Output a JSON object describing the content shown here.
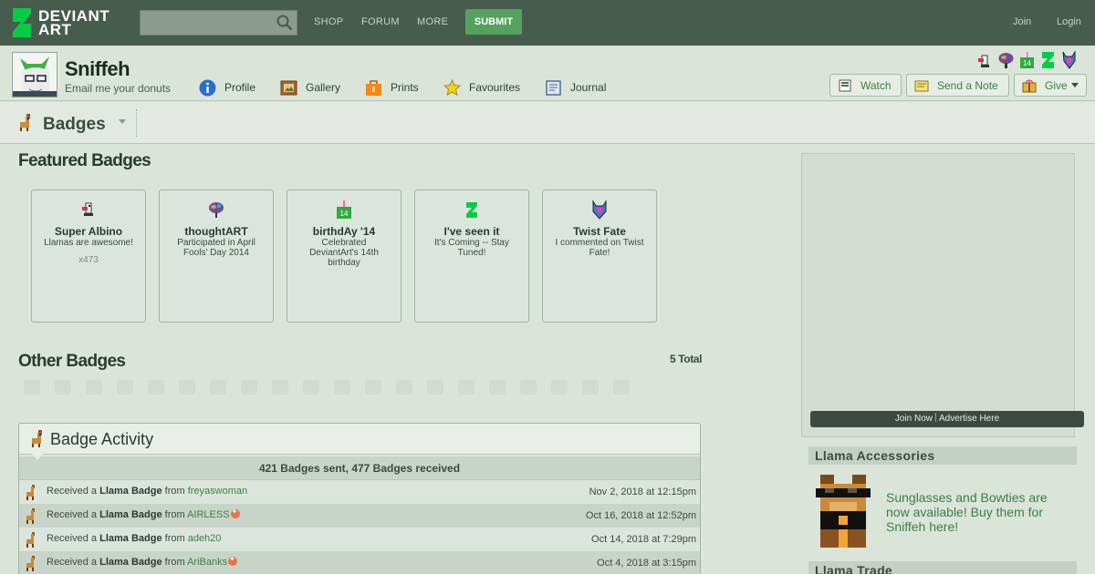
{
  "topbar": {
    "logo_text_1": "DEVIANT",
    "logo_text_2": "ART",
    "search_placeholder": "",
    "nav": [
      "SHOP",
      "FORUM",
      "MORE"
    ],
    "submit_label": "SUBMIT",
    "join_label": "Join",
    "login_label": "Login"
  },
  "profile": {
    "username": "Sniffeh",
    "tagline": "Email me your donuts",
    "tabs": [
      {
        "label": "Profile",
        "icon": "info-icon"
      },
      {
        "label": "Gallery",
        "icon": "gallery-icon"
      },
      {
        "label": "Prints",
        "icon": "prints-icon"
      },
      {
        "label": "Favourites",
        "icon": "star-icon"
      },
      {
        "label": "Journal",
        "icon": "journal-icon"
      }
    ],
    "buttons": {
      "watch": "Watch",
      "note": "Send a Note",
      "give": "Give"
    }
  },
  "section": {
    "title": "Badges"
  },
  "featured": {
    "heading": "Featured Badges",
    "badges": [
      {
        "name": "Super Albino",
        "desc": "Llamas are awesome!",
        "count": "x473"
      },
      {
        "name": "thoughtART",
        "desc": "Participated in April Fools' Day 2014",
        "count": ""
      },
      {
        "name": "birthdAy '14",
        "desc": "Celebrated DeviantArt's 14th birthday",
        "count": ""
      },
      {
        "name": "I've seen it",
        "desc": "It's Coming -- Stay Tuned!",
        "count": ""
      },
      {
        "name": "Twist Fate",
        "desc": "I commented on Twist Fate!",
        "count": ""
      }
    ]
  },
  "other": {
    "heading": "Other Badges",
    "total": "5 Total"
  },
  "activity": {
    "title": "Badge Activity",
    "summary": "421 Badges sent, 477 Badges received",
    "rows": [
      {
        "prefix": "Received a",
        "badge": "Llama Badge",
        "from": "from",
        "user": "freyaswoman",
        "date": "Nov 2, 2018 at 12:15pm",
        "core": false
      },
      {
        "prefix": "Received a",
        "badge": "Llama Badge",
        "from": "from",
        "user": "AIRLESS",
        "date": "Oct 16, 2018 at 12:52pm",
        "core": true
      },
      {
        "prefix": "Received a",
        "badge": "Llama Badge",
        "from": "from",
        "user": "adeh20",
        "date": "Oct 14, 2018 at 7:29pm",
        "core": false
      },
      {
        "prefix": "Received a",
        "badge": "Llama Badge",
        "from": "from",
        "user": "AriBanks",
        "date": "Oct 4, 2018 at 3:15pm",
        "core": true
      }
    ]
  },
  "sidebar": {
    "ad_join": "Join Now",
    "ad_advertise": "Advertise Here",
    "accessories_heading": "Llama Accessories",
    "accessories_text": "Sunglasses and Bowties are now available! Buy them for Sniffeh here!",
    "trade_heading": "Llama Trade"
  }
}
